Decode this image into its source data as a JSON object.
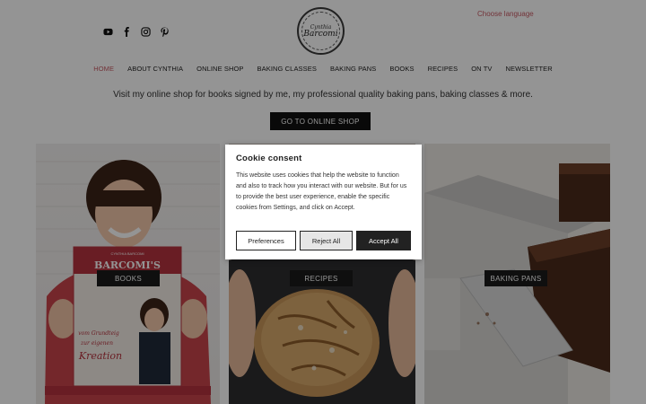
{
  "header": {
    "language_link": "Choose language",
    "logo": {
      "line1": "Cynthia",
      "line2": "Barcomi"
    },
    "social": [
      {
        "icon": "youtube-icon"
      },
      {
        "icon": "facebook-icon"
      },
      {
        "icon": "instagram-icon"
      },
      {
        "icon": "pinterest-icon"
      }
    ]
  },
  "nav": {
    "items": [
      {
        "label": "HOME",
        "active": true
      },
      {
        "label": "ABOUT CYNTHIA"
      },
      {
        "label": "ONLINE SHOP"
      },
      {
        "label": "BAKING CLASSES"
      },
      {
        "label": "BAKING PANS"
      },
      {
        "label": "BOOKS"
      },
      {
        "label": "RECIPES"
      },
      {
        "label": "ON TV"
      },
      {
        "label": "NEWSLETTER"
      }
    ]
  },
  "main": {
    "tagline": "Visit my online shop for books signed by me, my professional quality baking pans, baking classes & more.",
    "cta": "GO TO ONLINE SHOP",
    "tiles": [
      {
        "label": "BOOKS",
        "book_title": "BARCOMI'S",
        "book_author": "CYNTHIA BARCOMI",
        "book_sub1": "vom Grundteig",
        "book_sub2": "zur eigenen",
        "book_sub3": "Kreation"
      },
      {
        "label": "RECIPES"
      },
      {
        "label": "BAKING PANS"
      }
    ]
  },
  "cookie_consent": {
    "title": "Cookie consent",
    "body": "This website uses cookies that help the website to function and also to track how you interact with our website. But for us to provide the best user experience, enable the specific cookies from Settings, and click on Accept.",
    "preferences": "Preferences",
    "reject": "Reject All",
    "accept": "Accept All"
  },
  "colors": {
    "accent": "#c75a64",
    "button_dark": "#111111"
  }
}
